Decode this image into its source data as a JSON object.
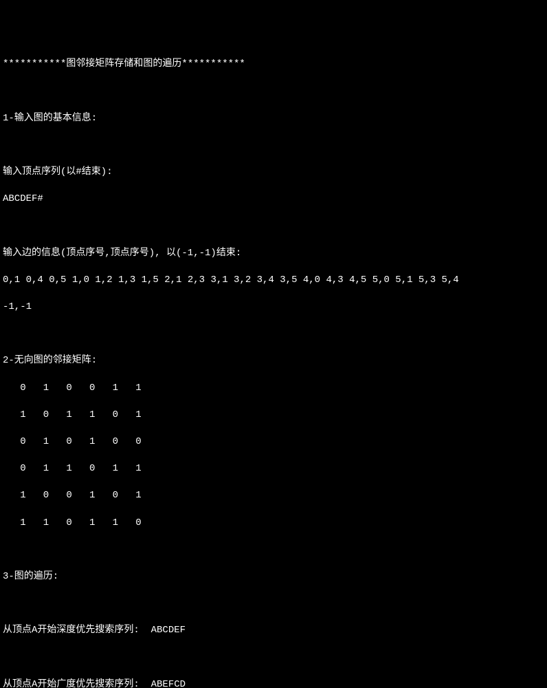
{
  "title_line": "***********图邻接矩阵存储和图的遍历***********",
  "section1_heading": "1-输入图的基本信息:",
  "vertex_prompt": "输入顶点序列(以#结束):",
  "vertex_input": "ABCDEF#",
  "edge_prompt": "输入边的信息(顶点序号,顶点序号), 以(-1,-1)结束:",
  "edge_input_line1": "0,1 0,4 0,5 1,0 1,2 1,3 1,5 2,1 2,3 3,1 3,2 3,4 3,5 4,0 4,3 4,5 5,0 5,1 5,3 5,4",
  "edge_input_line2": "-1,-1",
  "section2_heading": "2-无向图的邻接矩阵:",
  "matrix_row0": "   0   1   0   0   1   1",
  "matrix_row1": "   1   0   1   1   0   1",
  "matrix_row2": "   0   1   0   1   0   0",
  "matrix_row3": "   0   1   1   0   1   1",
  "matrix_row4": "   1   0   0   1   0   1",
  "matrix_row5": "   1   1   0   1   1   0",
  "section3_heading": "3-图的遍历:",
  "dfs_label": "从顶点A开始深度优先搜索序列:  ",
  "dfs_result": "ABCDEF",
  "bfs_label": "从顶点A开始广度优先搜索序列:  ",
  "bfs_result": "ABEFCD"
}
